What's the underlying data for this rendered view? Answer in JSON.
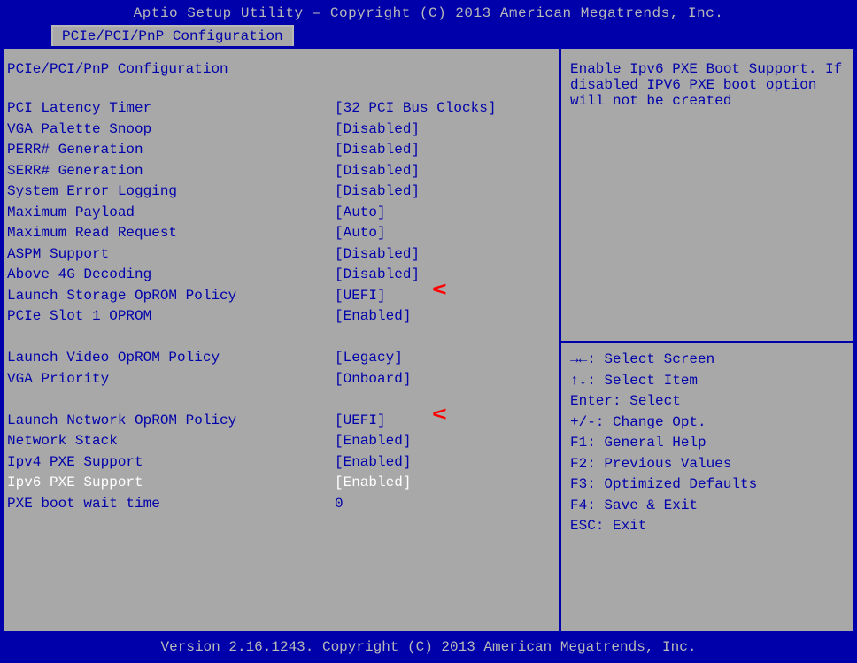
{
  "title": "Aptio Setup Utility – Copyright (C) 2013 American Megatrends, Inc.",
  "tab": "PCIe/PCI/PnP Configuration",
  "section_title": "PCIe/PCI/PnP Configuration",
  "rows": [
    {
      "label": "PCI Latency Timer",
      "value": "[32 PCI Bus Clocks]"
    },
    {
      "label": "VGA Palette Snoop",
      "value": "[Disabled]"
    },
    {
      "label": "PERR# Generation",
      "value": "[Disabled]"
    },
    {
      "label": "SERR# Generation",
      "value": "[Disabled]"
    },
    {
      "label": "System Error Logging",
      "value": "[Disabled]"
    },
    {
      "label": "Maximum Payload",
      "value": "[Auto]"
    },
    {
      "label": "Maximum Read Request",
      "value": "[Auto]"
    },
    {
      "label": "ASPM Support",
      "value": "[Disabled]"
    },
    {
      "label": "Above 4G Decoding",
      "value": "[Disabled]"
    },
    {
      "label": "Launch Storage OpROM Policy",
      "value": "[UEFI]",
      "arrow": true
    },
    {
      "label": "PCIe Slot 1 OPROM",
      "value": "[Enabled]"
    },
    {
      "spacer": true
    },
    {
      "label": "Launch Video OpROM Policy",
      "value": "[Legacy]"
    },
    {
      "label": "VGA Priority",
      "value": "[Onboard]"
    },
    {
      "spacer": true
    },
    {
      "label": "Launch Network OpROM Policy",
      "value": "[UEFI]",
      "arrow": true
    },
    {
      "label": "Network Stack",
      "value": "[Enabled]"
    },
    {
      "label": "Ipv4 PXE Support",
      "value": "[Enabled]"
    },
    {
      "label": "Ipv6 PXE Support",
      "value": "[Enabled]",
      "selected": true
    },
    {
      "label": "PXE boot wait time",
      "value": "0"
    }
  ],
  "help_text": "Enable Ipv6 PXE Boot Support. If disabled IPV6 PXE boot option will not be created",
  "help_keys": [
    "→←: Select Screen",
    "↑↓: Select Item",
    "Enter: Select",
    "+/-: Change Opt.",
    "F1: General Help",
    "F2: Previous Values",
    "F3: Optimized Defaults",
    "F4: Save & Exit",
    "ESC: Exit"
  ],
  "footer": "Version 2.16.1243. Copyright (C) 2013 American Megatrends, Inc."
}
